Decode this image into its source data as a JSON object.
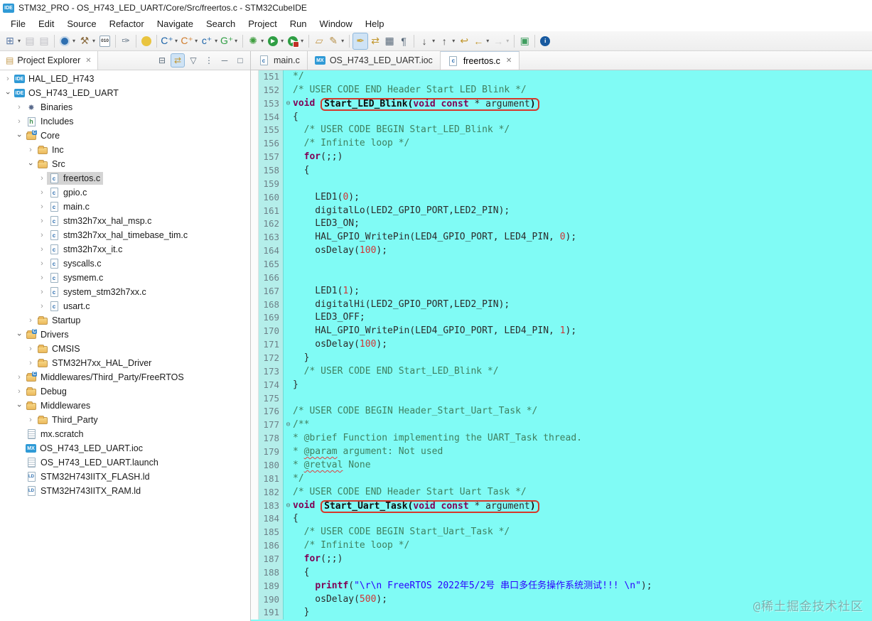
{
  "window": {
    "title": "STM32_PRO - OS_H743_LED_UART/Core/Src/freertos.c - STM32CubeIDE",
    "app_icon_label": "IDE"
  },
  "menu_bar": {
    "items": [
      "File",
      "Edit",
      "Source",
      "Refactor",
      "Navigate",
      "Search",
      "Project",
      "Run",
      "Window",
      "Help"
    ]
  },
  "main_toolbar": {
    "items": [
      {
        "name": "new-wizard-icon",
        "kind": "glyph",
        "glyph": "⊞",
        "color": "#5b79a5",
        "dropdown": true
      },
      {
        "name": "save-icon",
        "kind": "glyph",
        "glyph": "▤",
        "color": "#667",
        "disabled": true
      },
      {
        "name": "save-all-icon",
        "kind": "glyph",
        "glyph": "▤",
        "color": "#667",
        "disabled": true
      },
      {
        "sep": true
      },
      {
        "name": "stm32-target-icon",
        "kind": "circle",
        "bg": "#2e6fb0",
        "ring": true,
        "dropdown": true
      },
      {
        "name": "build-hammer-icon",
        "kind": "glyph",
        "glyph": "⚒",
        "color": "#8a6b3f",
        "dropdown": true
      },
      {
        "name": "binary-file-icon",
        "kind": "box",
        "text": "010"
      },
      {
        "sep": true
      },
      {
        "name": "soldering-tool-icon",
        "kind": "glyph",
        "glyph": "✑",
        "color": "#6a7b8c"
      },
      {
        "sep": true
      },
      {
        "name": "launch-lamp-icon",
        "kind": "circle",
        "bg": "#e9c43f"
      },
      {
        "sep": true
      },
      {
        "name": "new-c-project-icon",
        "kind": "glyph",
        "glyph": "C⁺",
        "color": "#1b63a8",
        "dropdown": true
      },
      {
        "name": "new-cpp-project-icon",
        "kind": "glyph",
        "glyph": "C⁺",
        "color": "#d07c2c",
        "dropdown": true
      },
      {
        "name": "new-c-file-icon",
        "kind": "glyph",
        "glyph": "c⁺",
        "color": "#1b63a8",
        "dropdown": true
      },
      {
        "name": "new-codegen-icon",
        "kind": "glyph",
        "glyph": "G⁺",
        "color": "#2f9e44",
        "dropdown": true
      },
      {
        "sep": true
      },
      {
        "name": "debug-bug-icon",
        "kind": "glyph",
        "glyph": "✺",
        "color": "#3f9e3f",
        "dropdown": true
      },
      {
        "name": "run-icon",
        "kind": "circle",
        "bg": "#2f9e44",
        "text": "▶",
        "dropdown": true
      },
      {
        "name": "profile-run-icon",
        "kind": "circle",
        "bg": "#2f9e44",
        "text": "▶",
        "badge": true,
        "dropdown": true
      },
      {
        "sep": true
      },
      {
        "name": "import-folder-icon",
        "kind": "glyph",
        "glyph": "▱",
        "color": "#c49a4e"
      },
      {
        "name": "format-brush-icon",
        "kind": "glyph",
        "glyph": "✎",
        "color": "#b58e46",
        "dropdown": true
      },
      {
        "sep": true
      },
      {
        "name": "mark-occurrences-icon",
        "kind": "glyph",
        "glyph": "✒",
        "color": "#caa53d",
        "toggled": true
      },
      {
        "name": "link-with-editor-icon",
        "kind": "glyph",
        "glyph": "⇄",
        "color": "#c2972e"
      },
      {
        "name": "block-selection-icon",
        "kind": "glyph",
        "glyph": "▦",
        "color": "#556677"
      },
      {
        "name": "show-whitespace-icon",
        "kind": "glyph",
        "glyph": "¶",
        "color": "#556677"
      },
      {
        "sep": true
      },
      {
        "name": "next-annotation-icon",
        "kind": "glyph",
        "glyph": "↓",
        "color": "#444",
        "dropdown": true
      },
      {
        "name": "prev-annotation-icon",
        "kind": "glyph",
        "glyph": "↑",
        "color": "#444",
        "dropdown": true
      },
      {
        "name": "last-edit-location-icon",
        "kind": "glyph",
        "glyph": "↩",
        "color": "#c2972e"
      },
      {
        "name": "back-icon",
        "kind": "glyph",
        "glyph": "←",
        "color": "#c2972e",
        "dropdown": true
      },
      {
        "name": "forward-icon",
        "kind": "glyph",
        "glyph": "→",
        "color": "#999",
        "disabled": true,
        "dropdown": true
      },
      {
        "sep": true
      },
      {
        "name": "pin-editor-icon",
        "kind": "glyph",
        "glyph": "▣",
        "color": "#3f9e5f"
      },
      {
        "sep": true
      },
      {
        "name": "info-icon",
        "kind": "circle",
        "bg": "#17599f",
        "text": "i"
      }
    ]
  },
  "project_explorer": {
    "title": "Project Explorer",
    "close_glyph": "✕",
    "tools": [
      {
        "name": "collapse-all-icon",
        "glyph": "⊟"
      },
      {
        "name": "link-with-editor-icon",
        "glyph": "⇄",
        "toggled": true
      },
      {
        "name": "filter-icon",
        "glyph": "▽"
      },
      {
        "name": "view-menu-icon",
        "glyph": "⋮"
      },
      {
        "name": "minimize-icon",
        "glyph": "─"
      },
      {
        "name": "maximize-icon",
        "glyph": "□"
      }
    ],
    "tree": [
      {
        "label": "HAL_LED_H743",
        "level": 0,
        "arrow": "collapsed",
        "icon": "ide"
      },
      {
        "label": "OS_H743_LED_UART",
        "level": 0,
        "arrow": "expanded",
        "icon": "ide"
      },
      {
        "label": "Binaries",
        "level": 1,
        "arrow": "collapsed",
        "icon": "bin"
      },
      {
        "label": "Includes",
        "level": 1,
        "arrow": "collapsed",
        "icon": "inc"
      },
      {
        "label": "Core",
        "level": 1,
        "arrow": "expanded",
        "icon": "folder-c"
      },
      {
        "label": "Inc",
        "level": 2,
        "arrow": "collapsed",
        "icon": "folder"
      },
      {
        "label": "Src",
        "level": 2,
        "arrow": "expanded",
        "icon": "folder"
      },
      {
        "label": "freertos.c",
        "level": 3,
        "arrow": "collapsed",
        "icon": "cfile",
        "selected": true
      },
      {
        "label": "gpio.c",
        "level": 3,
        "arrow": "collapsed",
        "icon": "cfile"
      },
      {
        "label": "main.c",
        "level": 3,
        "arrow": "collapsed",
        "icon": "cfile"
      },
      {
        "label": "stm32h7xx_hal_msp.c",
        "level": 3,
        "arrow": "collapsed",
        "icon": "cfile"
      },
      {
        "label": "stm32h7xx_hal_timebase_tim.c",
        "level": 3,
        "arrow": "collapsed",
        "icon": "cfile"
      },
      {
        "label": "stm32h7xx_it.c",
        "level": 3,
        "arrow": "collapsed",
        "icon": "cfile"
      },
      {
        "label": "syscalls.c",
        "level": 3,
        "arrow": "collapsed",
        "icon": "cfile"
      },
      {
        "label": "sysmem.c",
        "level": 3,
        "arrow": "collapsed",
        "icon": "cfile"
      },
      {
        "label": "system_stm32h7xx.c",
        "level": 3,
        "arrow": "collapsed",
        "icon": "cfile"
      },
      {
        "label": "usart.c",
        "level": 3,
        "arrow": "collapsed",
        "icon": "cfile"
      },
      {
        "label": "Startup",
        "level": 2,
        "arrow": "collapsed",
        "icon": "folder"
      },
      {
        "label": "Drivers",
        "level": 1,
        "arrow": "expanded",
        "icon": "folder-c"
      },
      {
        "label": "CMSIS",
        "level": 2,
        "arrow": "collapsed",
        "icon": "folder"
      },
      {
        "label": "STM32H7xx_HAL_Driver",
        "level": 2,
        "arrow": "collapsed",
        "icon": "folder"
      },
      {
        "label": "Middlewares/Third_Party/FreeRTOS",
        "level": 1,
        "arrow": "collapsed",
        "icon": "folder-c"
      },
      {
        "label": "Debug",
        "level": 1,
        "arrow": "collapsed",
        "icon": "folder"
      },
      {
        "label": "Middlewares",
        "level": 1,
        "arrow": "expanded",
        "icon": "folder"
      },
      {
        "label": "Third_Party",
        "level": 2,
        "arrow": "collapsed",
        "icon": "folder"
      },
      {
        "label": "mx.scratch",
        "level": 1,
        "arrow": null,
        "icon": "file"
      },
      {
        "label": "OS_H743_LED_UART.ioc",
        "level": 1,
        "arrow": null,
        "icon": "mx"
      },
      {
        "label": "OS_H743_LED_UART.launch",
        "level": 1,
        "arrow": null,
        "icon": "file"
      },
      {
        "label": "STM32H743IITX_FLASH.ld",
        "level": 1,
        "arrow": null,
        "icon": "ld"
      },
      {
        "label": "STM32H743IITX_RAM.ld",
        "level": 1,
        "arrow": null,
        "icon": "ld"
      }
    ]
  },
  "editor": {
    "tabs": [
      {
        "label": "main.c",
        "icon": "cfile",
        "active": false
      },
      {
        "label": "OS_H743_LED_UART.ioc",
        "icon": "mx",
        "active": false
      },
      {
        "label": "freertos.c",
        "icon": "cfile",
        "active": true,
        "close": "✕"
      }
    ],
    "colors": {
      "background": "#80fbf5",
      "gutter": "#b4eeea",
      "comment": "#3F7F5F",
      "keyword": "#7F0055",
      "string": "#2A00FF",
      "number": "#d03434",
      "highlight_box": "#d5382b"
    },
    "code": {
      "fold_glyph": "⊖",
      "lines": [
        {
          "n": 151,
          "segs": [
            {
              "t": "*/",
              "c": "cm"
            }
          ]
        },
        {
          "n": 152,
          "segs": [
            {
              "t": "/* USER CODE END Header Start LED Blink */",
              "c": "cm"
            }
          ]
        },
        {
          "n": 153,
          "fold": true,
          "segs": [
            {
              "t": "void ",
              "c": "kw"
            },
            {
              "box": [
                {
                  "t": "Start_LED_Blink(",
                  "c": "fn"
                },
                {
                  "t": "void const",
                  "c": "kw"
                },
                {
                  "t": " * argument",
                  "c": "pl"
                },
                {
                  "t": ")",
                  "c": "fn"
                }
              ]
            }
          ]
        },
        {
          "n": 154,
          "segs": [
            {
              "t": "{",
              "c": "pl"
            }
          ]
        },
        {
          "n": 155,
          "segs": [
            {
              "t": "  /* USER CODE BEGIN Start_LED_Blink */",
              "c": "cm"
            }
          ]
        },
        {
          "n": 156,
          "segs": [
            {
              "t": "  /* Infinite loop */",
              "c": "cm"
            }
          ]
        },
        {
          "n": 157,
          "segs": [
            {
              "t": "  ",
              "c": "pl"
            },
            {
              "t": "for",
              "c": "kw"
            },
            {
              "t": "(;;)",
              "c": "pl"
            }
          ]
        },
        {
          "n": 158,
          "segs": [
            {
              "t": "  {",
              "c": "pl"
            }
          ]
        },
        {
          "n": 159,
          "segs": []
        },
        {
          "n": 160,
          "segs": [
            {
              "t": "    LED1(",
              "c": "pl"
            },
            {
              "t": "0",
              "c": "num"
            },
            {
              "t": ");",
              "c": "pl"
            }
          ]
        },
        {
          "n": 161,
          "segs": [
            {
              "t": "    digitalLo(LED2_GPIO_PORT,LED2_PIN);",
              "c": "pl"
            }
          ]
        },
        {
          "n": 162,
          "segs": [
            {
              "t": "    LED3_ON;",
              "c": "pl"
            }
          ]
        },
        {
          "n": 163,
          "segs": [
            {
              "t": "    HAL_GPIO_WritePin(LED4_GPIO_PORT, LED4_PIN, ",
              "c": "pl"
            },
            {
              "t": "0",
              "c": "num"
            },
            {
              "t": ");",
              "c": "pl"
            }
          ]
        },
        {
          "n": 164,
          "segs": [
            {
              "t": "    osDelay(",
              "c": "pl"
            },
            {
              "t": "100",
              "c": "num"
            },
            {
              "t": ");",
              "c": "pl"
            }
          ]
        },
        {
          "n": 165,
          "segs": []
        },
        {
          "n": 166,
          "segs": []
        },
        {
          "n": 167,
          "segs": [
            {
              "t": "    LED1(",
              "c": "pl"
            },
            {
              "t": "1",
              "c": "num"
            },
            {
              "t": ");",
              "c": "pl"
            }
          ]
        },
        {
          "n": 168,
          "segs": [
            {
              "t": "    digitalHi(LED2_GPIO_PORT,LED2_PIN);",
              "c": "pl"
            }
          ]
        },
        {
          "n": 169,
          "segs": [
            {
              "t": "    LED3_OFF;",
              "c": "pl"
            }
          ]
        },
        {
          "n": 170,
          "segs": [
            {
              "t": "    HAL_GPIO_WritePin(LED4_GPIO_PORT, LED4_PIN, ",
              "c": "pl"
            },
            {
              "t": "1",
              "c": "num"
            },
            {
              "t": ");",
              "c": "pl"
            }
          ]
        },
        {
          "n": 171,
          "segs": [
            {
              "t": "    osDelay(",
              "c": "pl"
            },
            {
              "t": "100",
              "c": "num"
            },
            {
              "t": ");",
              "c": "pl"
            }
          ]
        },
        {
          "n": 172,
          "segs": [
            {
              "t": "  }",
              "c": "pl"
            }
          ]
        },
        {
          "n": 173,
          "segs": [
            {
              "t": "  /* USER CODE END Start_LED_Blink */",
              "c": "cm"
            }
          ]
        },
        {
          "n": 174,
          "segs": [
            {
              "t": "}",
              "c": "pl"
            }
          ]
        },
        {
          "n": 175,
          "segs": []
        },
        {
          "n": 176,
          "segs": [
            {
              "t": "/* USER CODE BEGIN Header_Start_Uart_Task */",
              "c": "cm"
            }
          ]
        },
        {
          "n": 177,
          "fold": true,
          "segs": [
            {
              "t": "/**",
              "c": "cm"
            }
          ]
        },
        {
          "n": 178,
          "segs": [
            {
              "t": "* @brief Function implementing the UART_Task thread.",
              "c": "cm"
            }
          ]
        },
        {
          "n": 179,
          "segs": [
            {
              "t": "* ",
              "c": "cm"
            },
            {
              "t": "@param",
              "c": "cmsp"
            },
            {
              "t": " argument: Not used",
              "c": "cm"
            }
          ]
        },
        {
          "n": 180,
          "segs": [
            {
              "t": "* ",
              "c": "cm"
            },
            {
              "t": "@retval",
              "c": "cmsp"
            },
            {
              "t": " None",
              "c": "cm"
            }
          ]
        },
        {
          "n": 181,
          "segs": [
            {
              "t": "*/",
              "c": "cm"
            }
          ]
        },
        {
          "n": 182,
          "segs": [
            {
              "t": "/* USER CODE END Header Start Uart Task */",
              "c": "cm"
            }
          ]
        },
        {
          "n": 183,
          "fold": true,
          "segs": [
            {
              "t": "void ",
              "c": "kw"
            },
            {
              "box": [
                {
                  "t": "Start_Uart_Task(",
                  "c": "fn"
                },
                {
                  "t": "void const",
                  "c": "kw"
                },
                {
                  "t": " * argument",
                  "c": "pl"
                },
                {
                  "t": ")",
                  "c": "fn"
                }
              ]
            }
          ]
        },
        {
          "n": 184,
          "segs": [
            {
              "t": "{",
              "c": "pl"
            }
          ]
        },
        {
          "n": 185,
          "segs": [
            {
              "t": "  /* USER CODE BEGIN Start_Uart_Task */",
              "c": "cm"
            }
          ]
        },
        {
          "n": 186,
          "segs": [
            {
              "t": "  /* Infinite loop */",
              "c": "cm"
            }
          ]
        },
        {
          "n": 187,
          "segs": [
            {
              "t": "  ",
              "c": "pl"
            },
            {
              "t": "for",
              "c": "kw"
            },
            {
              "t": "(;;)",
              "c": "pl"
            }
          ]
        },
        {
          "n": 188,
          "segs": [
            {
              "t": "  {",
              "c": "pl"
            }
          ]
        },
        {
          "n": 189,
          "segs": [
            {
              "t": "    ",
              "c": "pl"
            },
            {
              "t": "printf",
              "c": "kw"
            },
            {
              "t": "(",
              "c": "pl"
            },
            {
              "t": "\"\\r\\n FreeRTOS 2022年5/2号 串口多任务操作系统测试!!! \\n\"",
              "c": "str"
            },
            {
              "t": ");",
              "c": "pl"
            }
          ]
        },
        {
          "n": 190,
          "segs": [
            {
              "t": "    osDelay(",
              "c": "pl"
            },
            {
              "t": "500",
              "c": "num"
            },
            {
              "t": ");",
              "c": "pl"
            }
          ]
        },
        {
          "n": 191,
          "segs": [
            {
              "t": "  }",
              "c": "pl"
            }
          ]
        }
      ]
    }
  },
  "watermark": {
    "text": "@稀土掘金技术社区"
  }
}
